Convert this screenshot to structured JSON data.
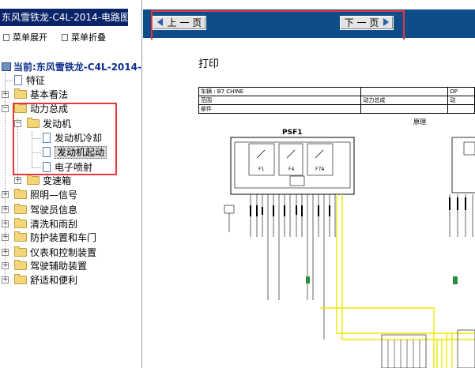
{
  "window": {
    "doc_title": "东风雪铁龙-C4L-2014-电路图"
  },
  "menu": {
    "expand_all": "菜单展开",
    "collapse_all": "菜单折叠"
  },
  "tree": {
    "current": "当前:东风雪铁龙-C4L-2014-电",
    "items": [
      {
        "label": "特征"
      },
      {
        "label": "基本看法"
      },
      {
        "label": "动力总成"
      },
      {
        "label": "发动机"
      },
      {
        "label": "发动机冷却"
      },
      {
        "label": "发动机起动"
      },
      {
        "label": "电子喷射"
      },
      {
        "label": "变速箱"
      },
      {
        "label": "照明—信号"
      },
      {
        "label": "驾驶员信息"
      },
      {
        "label": "清洗和雨刮"
      },
      {
        "label": "防护装置和车门"
      },
      {
        "label": "仪表和控制装置"
      },
      {
        "label": "驾驶辅助装置"
      },
      {
        "label": "舒适和便利"
      }
    ]
  },
  "nav": {
    "prev": "上 一 页",
    "next": "下 一 页"
  },
  "document": {
    "print_label": "打印",
    "header_rows": [
      [
        "车辆 : B7 CHINE",
        "",
        "OP"
      ],
      [
        "范围",
        "动力总成",
        "动"
      ],
      [
        "部件",
        "",
        ""
      ]
    ],
    "principle": "原理",
    "unit": "PSF1",
    "fuse_labels": [
      "F1",
      "F4",
      "F7A"
    ]
  },
  "colors": {
    "accent_red": "#e8343b",
    "toolbar_blue": "#0c4d8a",
    "wire_yellow": "#f2e600"
  }
}
